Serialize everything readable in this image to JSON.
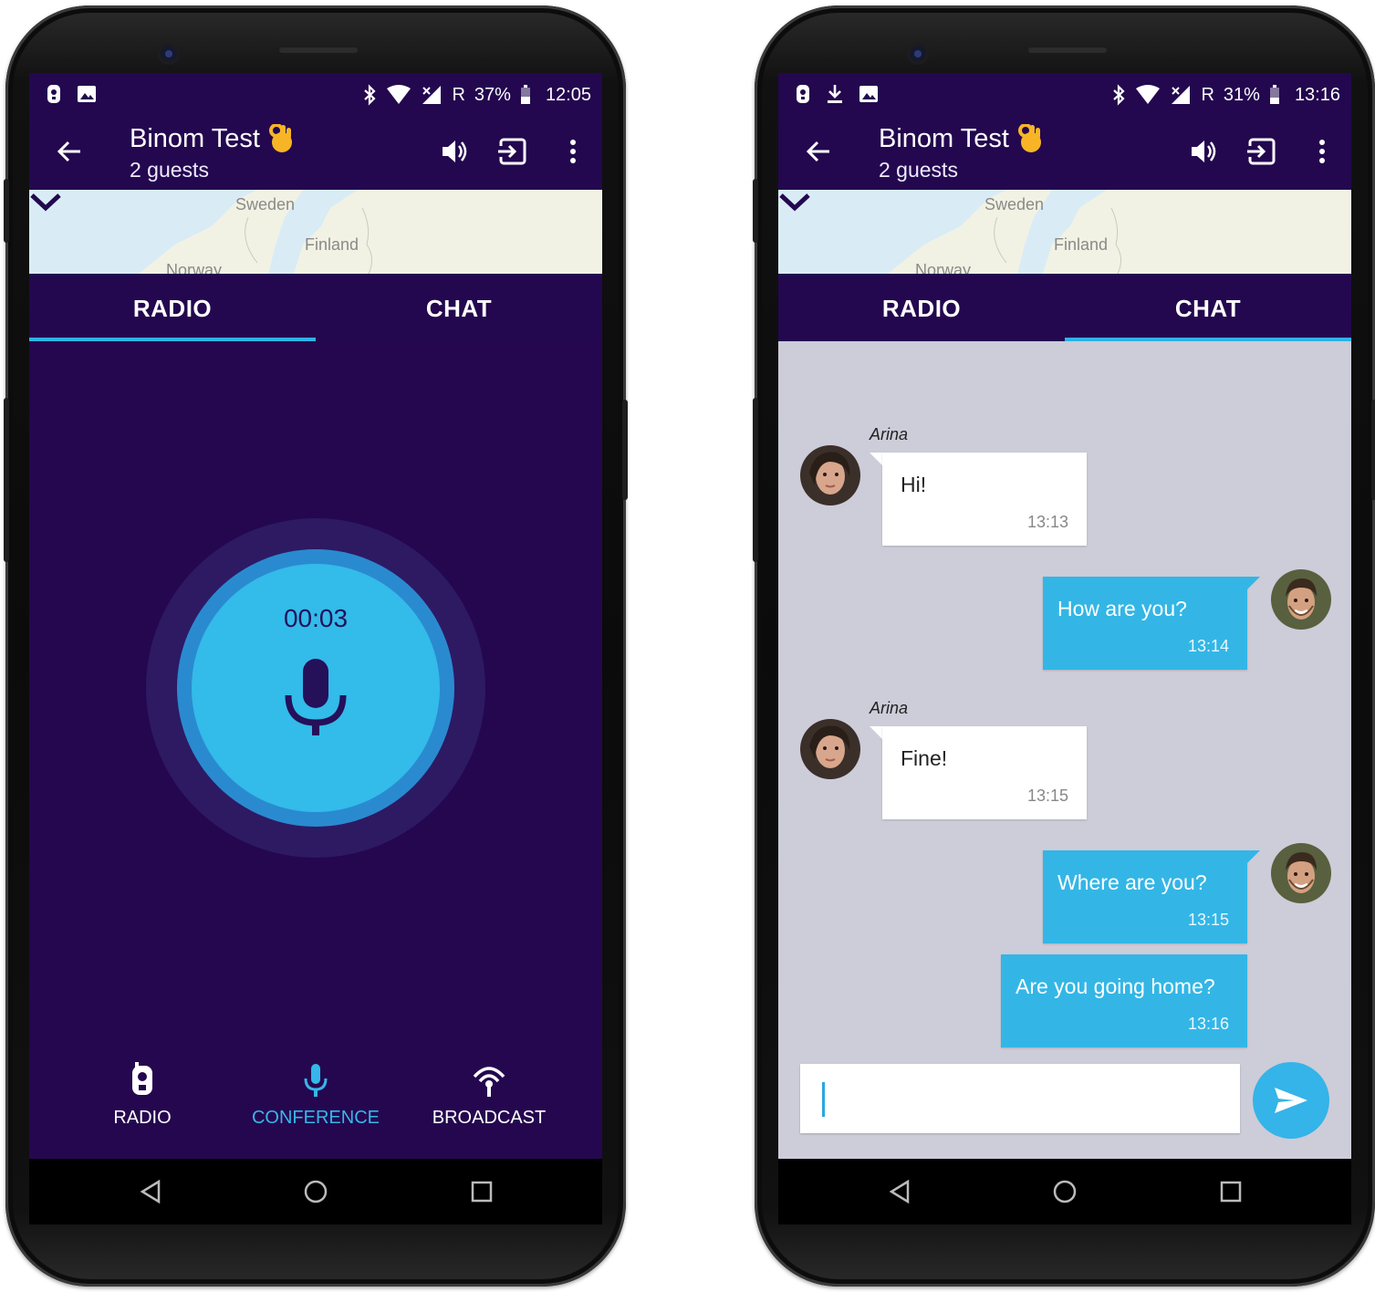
{
  "status_left": {
    "battery_pct": "37%",
    "time": "12:05",
    "network": "R"
  },
  "status_right": {
    "battery_pct": "31%",
    "time": "13:16",
    "network": "R"
  },
  "header": {
    "title": "Binom Test",
    "subtitle": "2 guests"
  },
  "map": {
    "labels": [
      "Sweden",
      "Finland",
      "Norway"
    ]
  },
  "tabs": [
    "RADIO",
    "CHAT"
  ],
  "radio": {
    "timer": "00:03",
    "modes": [
      "RADIO",
      "CONFERENCE",
      "BROADCAST"
    ],
    "active_mode": "CONFERENCE"
  },
  "chat": {
    "messages": [
      {
        "sender": "Arina",
        "text": "Hi!",
        "time": "13:13",
        "direction": "in"
      },
      {
        "sender": "",
        "text": "How are you?",
        "time": "13:14",
        "direction": "out"
      },
      {
        "sender": "Arina",
        "text": "Fine!",
        "time": "13:15",
        "direction": "in"
      },
      {
        "sender": "",
        "text": "Where are you?",
        "time": "13:15",
        "direction": "out"
      },
      {
        "sender": "",
        "text": "Are you going home?",
        "time": "13:16",
        "direction": "out"
      }
    ],
    "input_value": ""
  },
  "colors": {
    "app_bar": "#23084f",
    "radio_bg": "#25074f",
    "accent": "#33b6e6",
    "chat_bg": "#cdccd9"
  },
  "icons": [
    "back-arrow-icon",
    "volume-icon",
    "exit-icon",
    "more-vert-icon",
    "chevron-down-icon",
    "microphone-icon",
    "walkie-talkie-icon",
    "broadcast-icon",
    "send-icon",
    "nav-back-icon",
    "nav-home-icon",
    "nav-recents-icon"
  ]
}
